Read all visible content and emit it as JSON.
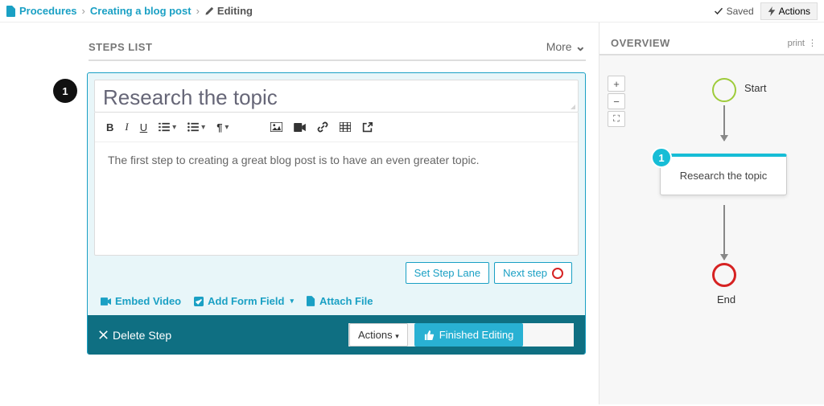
{
  "breadcrumbs": {
    "root": "Procedures",
    "parent": "Creating a blog post",
    "current": "Editing"
  },
  "top": {
    "saved": "Saved",
    "actions": "Actions"
  },
  "steps": {
    "header": "STEPS LIST",
    "more": "More",
    "number": "1",
    "title": "Research the topic",
    "body": "The first step to creating a great blog post is to have an even greater topic.",
    "set_lane": "Set Step Lane",
    "next_step": "Next step",
    "embed_video": "Embed Video",
    "add_form_field": "Add Form Field",
    "attach_file": "Attach File",
    "delete_step": "Delete Step",
    "actions": "Actions",
    "finished": "Finished Editing"
  },
  "overview": {
    "header": "OVERVIEW",
    "print": "print",
    "start": "Start",
    "node_num": "1",
    "node_label": "Research the topic",
    "end": "End"
  }
}
